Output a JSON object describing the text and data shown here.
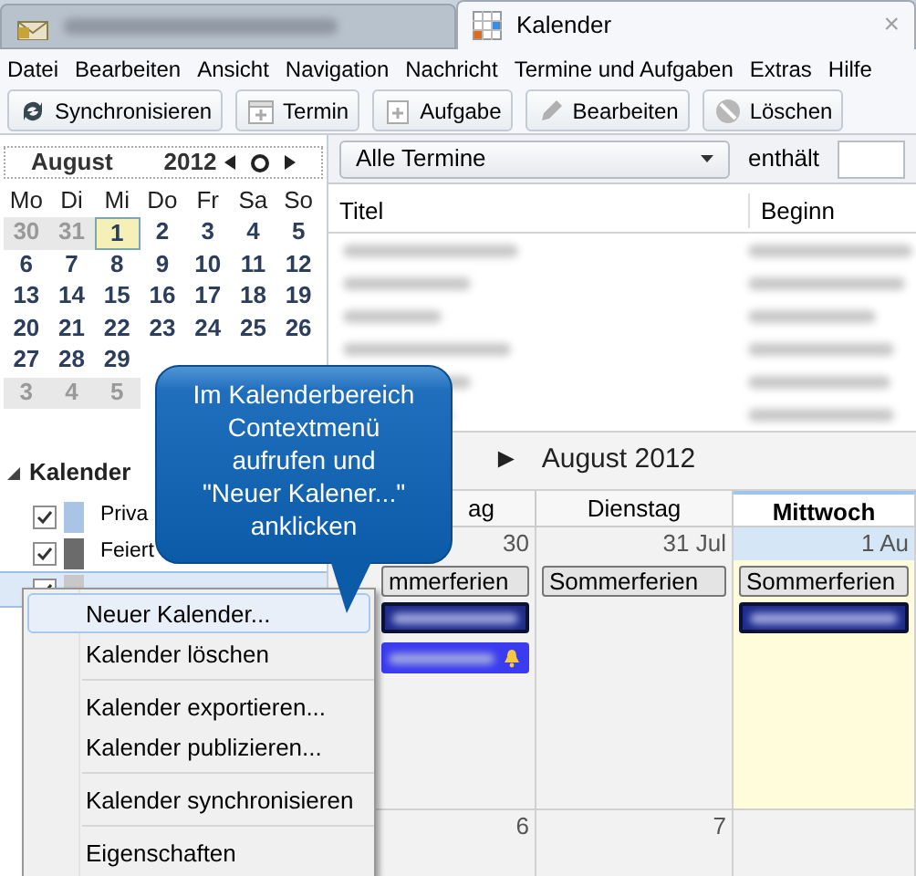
{
  "tabs": [
    {
      "kind": "mail",
      "selected": false
    },
    {
      "kind": "calendar",
      "label": "Kalender",
      "close": "×",
      "selected": true
    }
  ],
  "menu": [
    "Datei",
    "Bearbeiten",
    "Ansicht",
    "Navigation",
    "Nachricht",
    "Termine und Aufgaben",
    "Extras",
    "Hilfe"
  ],
  "toolbar": [
    {
      "kind": "sync",
      "label": "Synchronisieren"
    },
    {
      "kind": "event",
      "label": "Termin"
    },
    {
      "kind": "task",
      "label": "Aufgabe"
    },
    {
      "kind": "edit",
      "label": "Bearbeiten"
    },
    {
      "kind": "delete",
      "label": "Löschen"
    }
  ],
  "minimonth": {
    "month": "August",
    "year": "2012",
    "weekdays": [
      "Mo",
      "Di",
      "Mi",
      "Do",
      "Fr",
      "Sa",
      "So"
    ],
    "weeks": [
      [
        {
          "day": "30",
          "outside": true,
          "selected": false
        },
        {
          "day": "31",
          "outside": true,
          "selected": false
        },
        {
          "day": "1",
          "outside": false,
          "selected": true
        },
        {
          "day": "2",
          "outside": false,
          "selected": false
        },
        {
          "day": "3",
          "outside": false,
          "selected": false
        },
        {
          "day": "4",
          "outside": false,
          "selected": false
        },
        {
          "day": "5",
          "outside": false,
          "selected": false
        }
      ],
      [
        {
          "day": "6",
          "outside": false,
          "selected": false
        },
        {
          "day": "7",
          "outside": false,
          "selected": false
        },
        {
          "day": "8",
          "outside": false,
          "selected": false
        },
        {
          "day": "9",
          "outside": false,
          "selected": false
        },
        {
          "day": "10",
          "outside": false,
          "selected": false
        },
        {
          "day": "11",
          "outside": false,
          "selected": false
        },
        {
          "day": "12",
          "outside": false,
          "selected": false
        }
      ],
      [
        {
          "day": "13",
          "outside": false,
          "selected": false
        },
        {
          "day": "14",
          "outside": false,
          "selected": false
        },
        {
          "day": "15",
          "outside": false,
          "selected": false
        },
        {
          "day": "16",
          "outside": false,
          "selected": false
        },
        {
          "day": "17",
          "outside": false,
          "selected": false
        },
        {
          "day": "18",
          "outside": false,
          "selected": false
        },
        {
          "day": "19",
          "outside": false,
          "selected": false
        }
      ],
      [
        {
          "day": "20",
          "outside": false,
          "selected": false
        },
        {
          "day": "21",
          "outside": false,
          "selected": false
        },
        {
          "day": "22",
          "outside": false,
          "selected": false
        },
        {
          "day": "23",
          "outside": false,
          "selected": false
        },
        {
          "day": "24",
          "outside": false,
          "selected": false
        },
        {
          "day": "25",
          "outside": false,
          "selected": false
        },
        {
          "day": "26",
          "outside": false,
          "selected": false
        }
      ],
      [
        {
          "day": "27",
          "outside": false,
          "selected": false
        },
        {
          "day": "28",
          "outside": false,
          "selected": false
        },
        {
          "day": "29",
          "outside": false,
          "selected": false
        }
      ],
      [
        {
          "day": "3",
          "outside": true,
          "selected": false
        },
        {
          "day": "4",
          "outside": true,
          "selected": false
        },
        {
          "day": "5",
          "outside": true,
          "selected": false
        }
      ]
    ]
  },
  "calendars": {
    "title": "Kalender",
    "items": [
      {
        "name": "Priva",
        "checked": true,
        "color": "#a9c4e4",
        "selected": false
      },
      {
        "name": "Feiert",
        "checked": true,
        "color": "#6b6b6b",
        "selected": false
      },
      {
        "checked": true,
        "color": "#c8c8c8",
        "selected": true
      }
    ]
  },
  "filter": {
    "dropdown": "Alle Termine",
    "label": "enthält"
  },
  "event_list": {
    "columns": [
      "Titel",
      "Beginn"
    ]
  },
  "month_view": {
    "nav_arrow": "►",
    "title": "August 2012",
    "columns": [
      {
        "label": "ag",
        "selected": false
      },
      {
        "label": "Dienstag",
        "selected": false
      },
      {
        "label": "Mittwoch",
        "selected": true
      }
    ],
    "weeks": [
      [
        {
          "date": "30",
          "events": [
            {
              "kind": "allday",
              "title": "mmerferien"
            },
            {
              "kind": "blurred"
            },
            {
              "kind": "blurred_alarm"
            }
          ]
        },
        {
          "date": "31 Jul",
          "events": [
            {
              "kind": "allday",
              "title": "Sommerferien"
            }
          ]
        },
        {
          "date": "1 Au",
          "events": [
            {
              "kind": "allday",
              "title": "Sommerferien"
            },
            {
              "kind": "blurred"
            }
          ]
        }
      ],
      [
        {
          "date": "6"
        },
        {
          "date": "7"
        }
      ]
    ]
  },
  "context_menu": [
    {
      "kind": "item",
      "label": "Neuer Kalender...",
      "selected": true
    },
    {
      "kind": "item",
      "label": "Kalender löschen",
      "selected": false
    },
    {
      "kind": "separator"
    },
    {
      "kind": "item",
      "label": "Kalender exportieren...",
      "selected": false
    },
    {
      "kind": "item",
      "label": "Kalender publizieren...",
      "selected": false
    },
    {
      "kind": "separator"
    },
    {
      "kind": "item",
      "label": "Kalender synchronisieren",
      "selected": false
    },
    {
      "kind": "separator"
    },
    {
      "kind": "item",
      "label": "Eigenschaften",
      "selected": false
    }
  ],
  "callout": {
    "lines": [
      "Im Kalenderbereich",
      "Contextmenü",
      "aufrufen und",
      "\"Neuer Kalener...\"",
      "anklicken"
    ]
  }
}
